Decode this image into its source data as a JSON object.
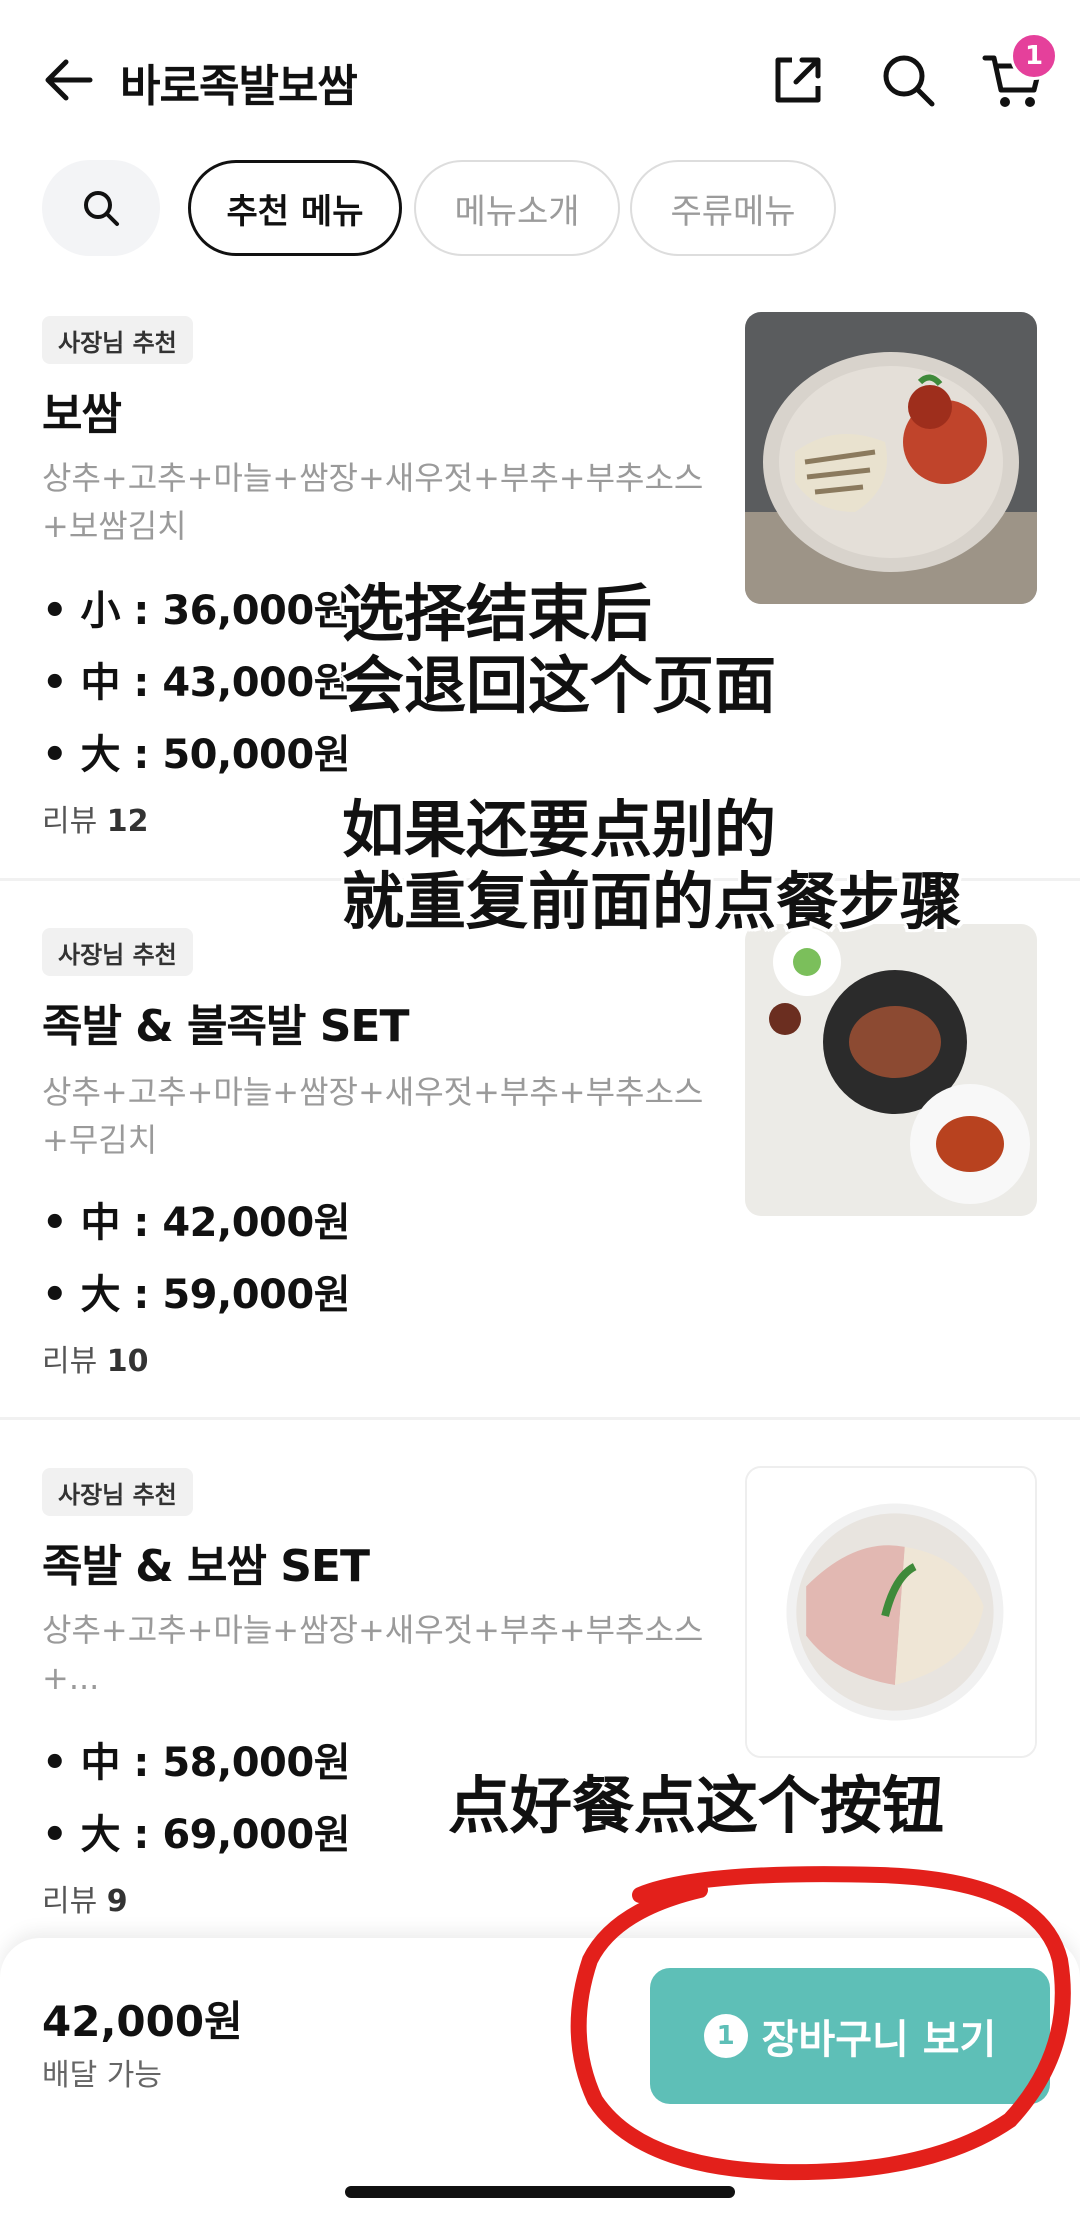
{
  "header": {
    "title": "바로족발보쌈",
    "cart_count": "1"
  },
  "tabs": [
    {
      "label": "추천 메뉴"
    },
    {
      "label": "메뉴소개"
    },
    {
      "label": "주류메뉴"
    }
  ],
  "items": [
    {
      "badge": "사장님 추천",
      "name": "보쌈",
      "desc": "상추+고추+마늘+쌈장+새우젓+부추+부추소스+보쌈김치",
      "prices": [
        "• 小 : 36,000원",
        "• 中 : 43,000원",
        "• 大 : 50,000원"
      ],
      "review_label": "리뷰",
      "review_count": "12"
    },
    {
      "badge": "사장님 추천",
      "name": "족발 & 불족발 SET",
      "desc": "상추+고추+마늘+쌈장+새우젓+부추+부추소스+무김치",
      "prices": [
        "• 中 : 42,000원",
        "• 大 : 59,000원"
      ],
      "review_label": "리뷰",
      "review_count": "10"
    },
    {
      "badge": "사장님 추천",
      "name": "족발 & 보쌈 SET",
      "desc": "상추+고추+마늘+쌈장+새우젓+부추+부추소스+...",
      "prices": [
        "• 中 : 58,000원",
        "• 大 : 69,000원"
      ],
      "review_label": "리뷰",
      "review_count": "9"
    }
  ],
  "notes": {
    "note1_line1": "选择结束后",
    "note1_line2": "会退回这个页面",
    "note2_line1": "如果还要点别的",
    "note2_line2": "就重复前面的点餐步骤",
    "note3": "点好餐点这个按钮"
  },
  "bottom": {
    "total": "42,000원",
    "delivery": "배달 가능",
    "cart_badge": "1",
    "cart_label": "장바구니 보기"
  },
  "colors": {
    "accent": "#5ebfb7",
    "badge_pink": "#e5409b",
    "annotation_red": "#e3201b"
  }
}
